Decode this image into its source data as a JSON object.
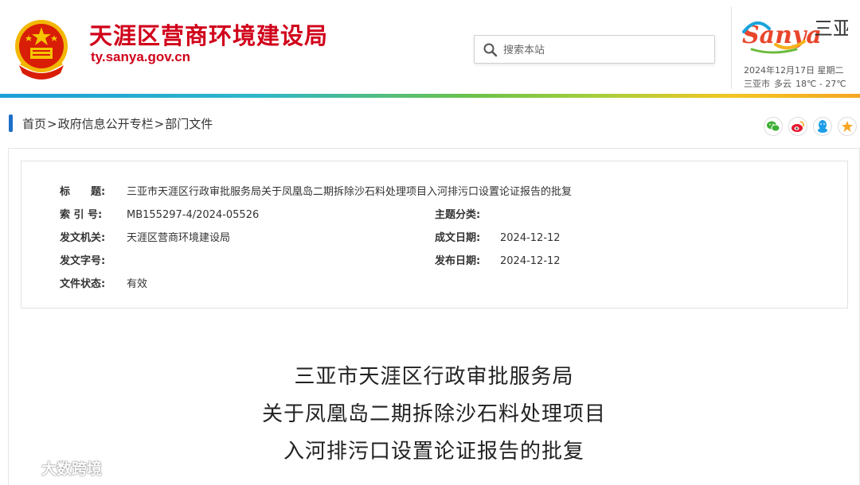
{
  "header": {
    "site_title": "天涯区营商环境建设局",
    "site_domain": "ty.sanya.gov.cn",
    "search_placeholder": "搜索本站",
    "logo_script": "Sanya",
    "logo_cn": "三亚",
    "date": "2024年12月17日 星期二",
    "weather": {
      "city": "三亚市",
      "condition": "多云",
      "temp_range": "18℃ - 27℃"
    }
  },
  "breadcrumb": {
    "items": [
      "首页",
      "政府信息公开专栏",
      "部门文件"
    ],
    "separator": ">"
  },
  "share_icons": [
    "wechat-icon",
    "weibo-icon",
    "qq-icon",
    "favorite-icon"
  ],
  "meta": {
    "title_label": "标　　题:",
    "title_value": "三亚市天涯区行政审批服务局关于凤凰岛二期拆除沙石料处理项目入河排污口设置论证报告的批复",
    "index_label": "索 引 号:",
    "index_value": "MB155297-4/2024-05526",
    "topic_label": "主题分类:",
    "topic_value": "",
    "issuer_label": "发文机关:",
    "issuer_value": "天涯区营商环境建设局",
    "created_label": "成文日期:",
    "created_value": "2024-12-12",
    "docno_label": "发文字号:",
    "docno_value": "",
    "published_label": "发布日期:",
    "published_value": "2024-12-12",
    "status_label": "文件状态:",
    "status_value": "有效"
  },
  "document": {
    "title_lines": [
      "三亚市天涯区行政审批服务局",
      "关于凤凰岛二期拆除沙石料处理项目",
      "入河排污口设置论证报告的批复"
    ]
  },
  "watermark": "大数跨境",
  "colors": {
    "brand_red": "#d0021b",
    "accent_blue": "#1e6fc9"
  }
}
